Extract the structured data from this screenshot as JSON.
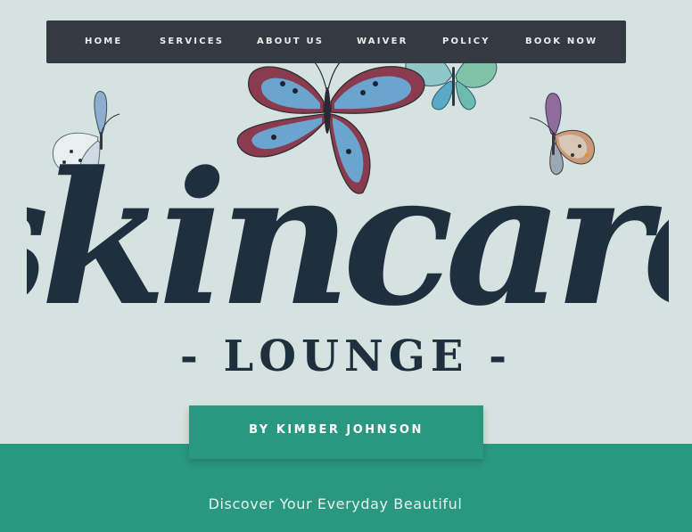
{
  "nav": {
    "items": [
      {
        "label": "HOME"
      },
      {
        "label": "SERVICES"
      },
      {
        "label": "ABOUT US"
      },
      {
        "label": "WAIVER"
      },
      {
        "label": "POLICY"
      },
      {
        "label": "BOOK NOW"
      }
    ]
  },
  "hero": {
    "script_title": "skincare",
    "subtitle": "- LOUNGE -",
    "byline": "BY KIMBER JOHNSON",
    "tagline": "Discover Your Everyday Beautiful"
  },
  "colors": {
    "background": "#d4e3df",
    "nav_bg": "#333a42",
    "title_ink": "#1f2f3d",
    "accent_green": "#2a9880"
  },
  "icons": [
    "butterfly-icon"
  ]
}
